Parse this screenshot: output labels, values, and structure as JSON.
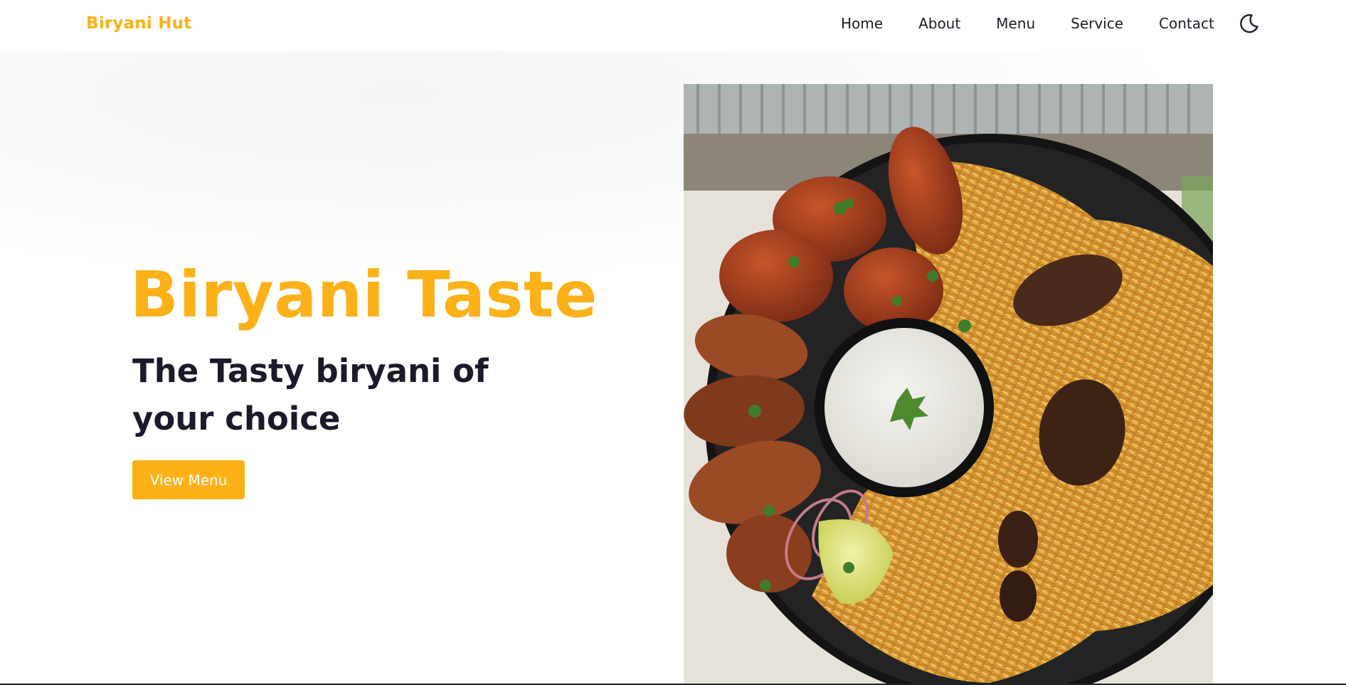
{
  "navbar": {
    "brand": "Biryani Hut",
    "links": [
      "Home",
      "About",
      "Menu",
      "Service",
      "Contact"
    ],
    "theme_toggle_icon": "moon-icon"
  },
  "hero": {
    "title": "Biryani Taste",
    "subtitle": "The Tasty biryani of your choice",
    "cta_label": "View Menu"
  },
  "colors": {
    "accent": "#fbb117",
    "heading_dark": "#1b1a2b",
    "nav_text": "#1d1d2b",
    "background": "#ffffff"
  },
  "hero_image": {
    "icon": "biryani-platter-image"
  }
}
